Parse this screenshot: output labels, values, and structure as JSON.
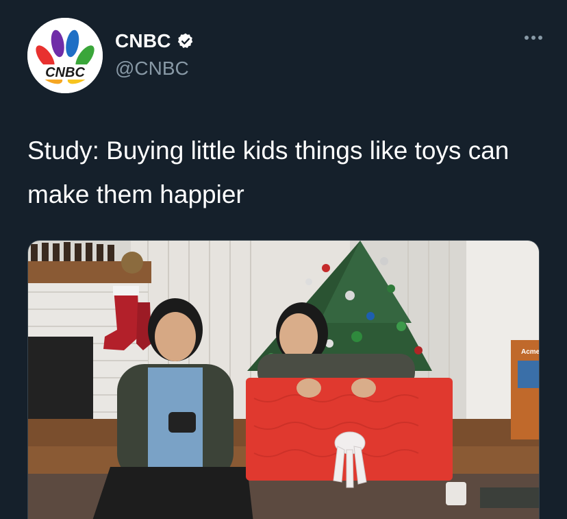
{
  "account": {
    "display_name": "CNBC",
    "handle": "@CNBC",
    "verified": true,
    "avatar_logo_text": "CNBC"
  },
  "tweet": {
    "text": "Study: Buying little kids things like toys can make them happier"
  },
  "media": {
    "type": "photo",
    "box_label": "Acme"
  },
  "icons": {
    "verified": "verified-badge-icon",
    "more": "more-options-icon"
  },
  "colors": {
    "background": "#15202b",
    "text_primary": "#ffffff",
    "text_secondary": "#8899a6",
    "gift_wrap": "#e0392f"
  }
}
